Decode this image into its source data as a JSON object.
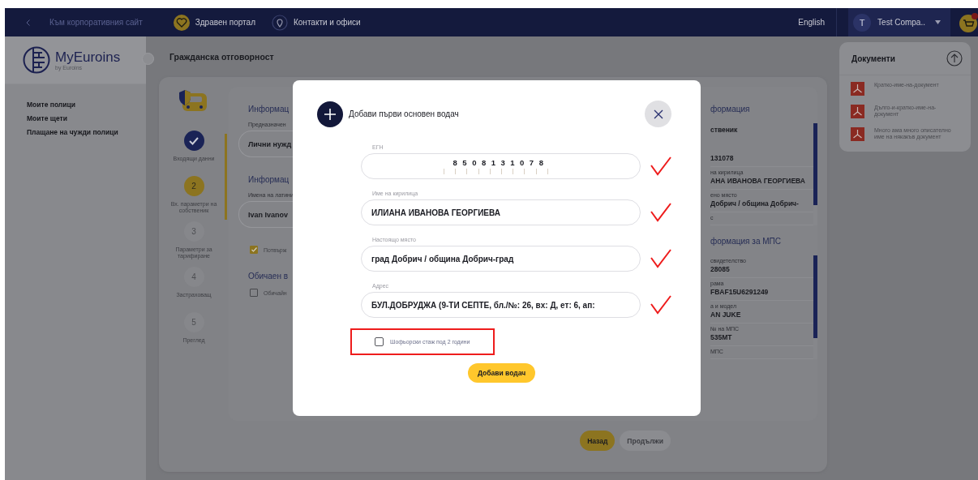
{
  "top_bar": {
    "back_link": "Към корпоративния сайт",
    "links": [
      {
        "label": "Здравен портал",
        "kind": "health"
      },
      {
        "label": "Контакти и офиси",
        "kind": "contacts"
      }
    ],
    "language": "English",
    "user": {
      "initial": "T",
      "name": "Test Compa.."
    }
  },
  "sidebar": {
    "logo": "MyEuroins",
    "logo_sub": "by Euroins",
    "items": [
      {
        "label": "Моите полици"
      },
      {
        "label": "Моите щети"
      },
      {
        "label": "Плащане на чужди полици"
      }
    ]
  },
  "page_title": "Гражданска отговорност",
  "stepper": [
    {
      "label": "Входящи данни",
      "completed": true,
      "selected": false
    },
    {
      "number": "2",
      "label": "Вх. параметри на собственик",
      "completed": false,
      "selected": true
    },
    {
      "number": "3",
      "label": "Параметри за тарифиране",
      "completed": false,
      "selected": false
    },
    {
      "number": "4",
      "label": "Застраховащ",
      "completed": false,
      "selected": false
    },
    {
      "number": "5",
      "label": "Преглед",
      "completed": false,
      "selected": false
    }
  ],
  "form": [
    {
      "kind": "heading",
      "text": "Информац"
    },
    {
      "kind": "label",
      "text": "Предназначен"
    },
    {
      "kind": "field",
      "text": "Лични нужд"
    },
    {
      "kind": "heading",
      "text": "Информац"
    },
    {
      "kind": "label",
      "text": "Имена на латини"
    },
    {
      "kind": "field",
      "text": "Ivan Ivanov"
    },
    {
      "kind": "checkbox",
      "text": "Потвърж",
      "checked": true
    },
    {
      "kind": "heading",
      "text": "Обичаен в"
    },
    {
      "kind": "checkbox",
      "text": "Обичайн",
      "checked": false
    }
  ],
  "summary": [
    {
      "title": "формация",
      "rows": [
        {
          "kind": "subheading",
          "value": "ственик"
        },
        {
          "kind": "row",
          "value": "131078"
        },
        {
          "kind": "row",
          "label": "на кирилица",
          "value": "АНА ИВАНОВА ГЕОРГИЕВА"
        },
        {
          "kind": "row",
          "label": "ено място",
          "value": "Добрич / община Добрич-"
        },
        {
          "kind": "row",
          "label": "с"
        }
      ]
    },
    {
      "title": "формация за МПС",
      "rows": [
        {
          "kind": "row",
          "label": "свидетелство",
          "value": "28085"
        },
        {
          "kind": "row",
          "label": "рама",
          "value": "FBAF15U6291249"
        },
        {
          "kind": "row",
          "label": "а и модел",
          "value": "AN JUKE"
        },
        {
          "kind": "row",
          "label": "№ на МПС",
          "value": "535МТ"
        },
        {
          "kind": "row",
          "label": "МПС"
        }
      ]
    }
  ],
  "footer_buttons": [
    {
      "label": "Назад",
      "disabled": false
    },
    {
      "label": "Продължи",
      "disabled": true
    }
  ],
  "documents": {
    "title": "Документи",
    "items": [
      {
        "name": "Кратко-име-на-документ"
      },
      {
        "name": "Дълго-и-кратко-име-на-документ"
      },
      {
        "name": "Много ама много описателно име на някакъв документ"
      }
    ]
  },
  "modal": {
    "title": "Добави първи основен водач",
    "fields": [
      {
        "label": "ЕГН",
        "value": "8508131078",
        "kind": "digits",
        "marked": true
      },
      {
        "label": "Име на кирилица",
        "value": "ИЛИАНА ИВАНОВА ГЕОРГИЕВА",
        "kind": "text",
        "marked": true
      },
      {
        "label": "Настоящо място",
        "value": "град Добрич / община Добрич-град",
        "kind": "text",
        "marked": true
      },
      {
        "label": "Адрес",
        "value": "БУЛ.ДОБРУДЖА (9-ТИ СЕПТЕ, бл./№: 26, вх: Д, ет: 6, ап:",
        "kind": "text",
        "marked": true
      }
    ],
    "checkbox": {
      "label": "Шофьорски стаж под 2 години",
      "checked": false,
      "highlighted": true
    },
    "submit": "Добави водач"
  }
}
